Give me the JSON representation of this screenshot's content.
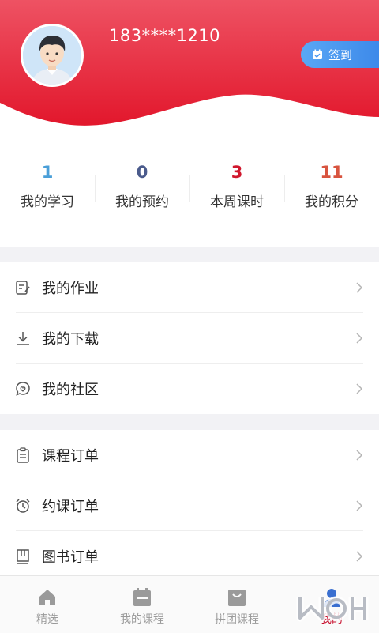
{
  "profile": {
    "phone": "183****1210",
    "signin_label": "签到"
  },
  "stats": [
    {
      "value": "1",
      "label": "我的学习",
      "color": "#4a9fd8"
    },
    {
      "value": "0",
      "label": "我的预约",
      "color": "#4b5b8c"
    },
    {
      "value": "3",
      "label": "本周课时",
      "color": "#d0172d"
    },
    {
      "value": "11",
      "label": "我的积分",
      "color": "#d8543f"
    }
  ],
  "menu_group_1": [
    {
      "label": "我的作业",
      "icon": "homework-icon"
    },
    {
      "label": "我的下载",
      "icon": "download-icon"
    },
    {
      "label": "我的社区",
      "icon": "community-icon"
    }
  ],
  "menu_group_2": [
    {
      "label": "课程订单",
      "icon": "clipboard-icon"
    },
    {
      "label": "约课订单",
      "icon": "alarm-clock-icon"
    },
    {
      "label": "图书订单",
      "icon": "book-icon"
    }
  ],
  "tabbar": [
    {
      "label": "精选",
      "icon": "home-icon"
    },
    {
      "label": "我的课程",
      "icon": "calendar-icon"
    },
    {
      "label": "拼团课程",
      "icon": "shopping-bag-icon"
    },
    {
      "label": "我的",
      "icon": "user-icon",
      "active": true
    }
  ],
  "colors": {
    "brand_red": "#e8192f",
    "signin_blue": "#4a96ef",
    "active_tab": "#c8102e"
  }
}
